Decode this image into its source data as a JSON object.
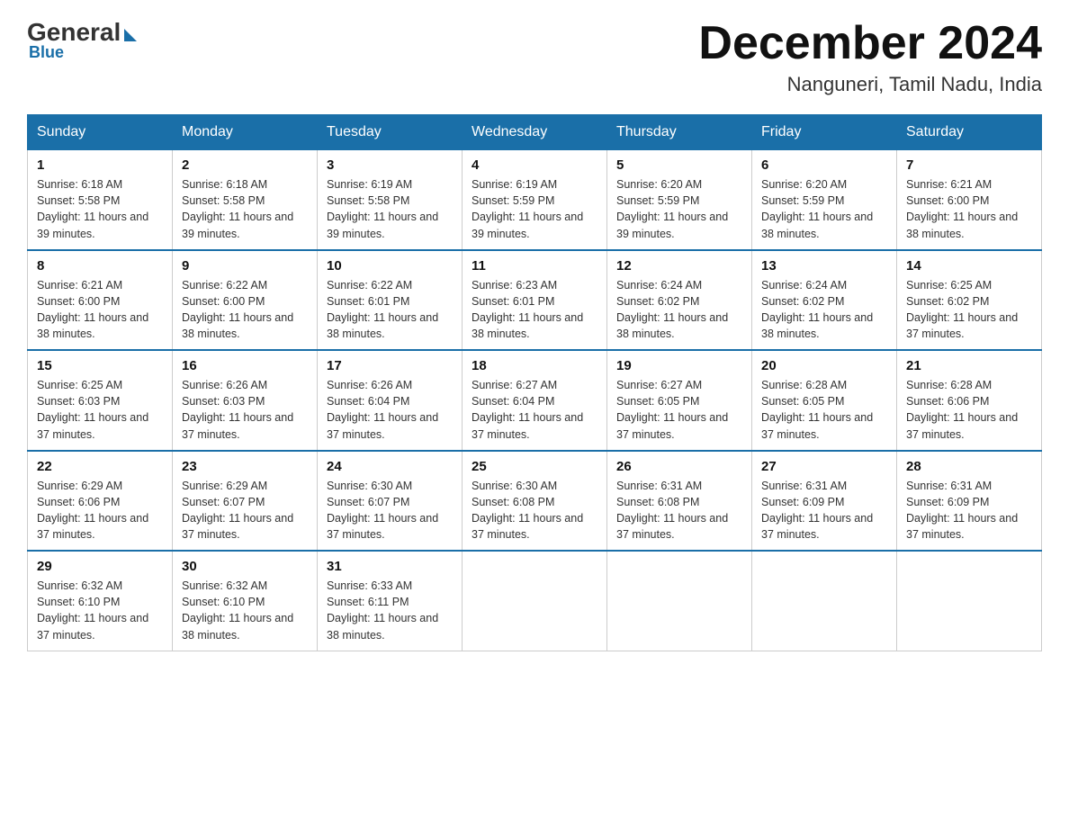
{
  "header": {
    "logo_general": "General",
    "logo_blue": "Blue",
    "month_title": "December 2024",
    "location": "Nanguneri, Tamil Nadu, India"
  },
  "days_of_week": [
    "Sunday",
    "Monday",
    "Tuesday",
    "Wednesday",
    "Thursday",
    "Friday",
    "Saturday"
  ],
  "weeks": [
    [
      {
        "day": "1",
        "sunrise": "6:18 AM",
        "sunset": "5:58 PM",
        "daylight": "11 hours and 39 minutes."
      },
      {
        "day": "2",
        "sunrise": "6:18 AM",
        "sunset": "5:58 PM",
        "daylight": "11 hours and 39 minutes."
      },
      {
        "day": "3",
        "sunrise": "6:19 AM",
        "sunset": "5:58 PM",
        "daylight": "11 hours and 39 minutes."
      },
      {
        "day": "4",
        "sunrise": "6:19 AM",
        "sunset": "5:59 PM",
        "daylight": "11 hours and 39 minutes."
      },
      {
        "day": "5",
        "sunrise": "6:20 AM",
        "sunset": "5:59 PM",
        "daylight": "11 hours and 39 minutes."
      },
      {
        "day": "6",
        "sunrise": "6:20 AM",
        "sunset": "5:59 PM",
        "daylight": "11 hours and 38 minutes."
      },
      {
        "day": "7",
        "sunrise": "6:21 AM",
        "sunset": "6:00 PM",
        "daylight": "11 hours and 38 minutes."
      }
    ],
    [
      {
        "day": "8",
        "sunrise": "6:21 AM",
        "sunset": "6:00 PM",
        "daylight": "11 hours and 38 minutes."
      },
      {
        "day": "9",
        "sunrise": "6:22 AM",
        "sunset": "6:00 PM",
        "daylight": "11 hours and 38 minutes."
      },
      {
        "day": "10",
        "sunrise": "6:22 AM",
        "sunset": "6:01 PM",
        "daylight": "11 hours and 38 minutes."
      },
      {
        "day": "11",
        "sunrise": "6:23 AM",
        "sunset": "6:01 PM",
        "daylight": "11 hours and 38 minutes."
      },
      {
        "day": "12",
        "sunrise": "6:24 AM",
        "sunset": "6:02 PM",
        "daylight": "11 hours and 38 minutes."
      },
      {
        "day": "13",
        "sunrise": "6:24 AM",
        "sunset": "6:02 PM",
        "daylight": "11 hours and 38 minutes."
      },
      {
        "day": "14",
        "sunrise": "6:25 AM",
        "sunset": "6:02 PM",
        "daylight": "11 hours and 37 minutes."
      }
    ],
    [
      {
        "day": "15",
        "sunrise": "6:25 AM",
        "sunset": "6:03 PM",
        "daylight": "11 hours and 37 minutes."
      },
      {
        "day": "16",
        "sunrise": "6:26 AM",
        "sunset": "6:03 PM",
        "daylight": "11 hours and 37 minutes."
      },
      {
        "day": "17",
        "sunrise": "6:26 AM",
        "sunset": "6:04 PM",
        "daylight": "11 hours and 37 minutes."
      },
      {
        "day": "18",
        "sunrise": "6:27 AM",
        "sunset": "6:04 PM",
        "daylight": "11 hours and 37 minutes."
      },
      {
        "day": "19",
        "sunrise": "6:27 AM",
        "sunset": "6:05 PM",
        "daylight": "11 hours and 37 minutes."
      },
      {
        "day": "20",
        "sunrise": "6:28 AM",
        "sunset": "6:05 PM",
        "daylight": "11 hours and 37 minutes."
      },
      {
        "day": "21",
        "sunrise": "6:28 AM",
        "sunset": "6:06 PM",
        "daylight": "11 hours and 37 minutes."
      }
    ],
    [
      {
        "day": "22",
        "sunrise": "6:29 AM",
        "sunset": "6:06 PM",
        "daylight": "11 hours and 37 minutes."
      },
      {
        "day": "23",
        "sunrise": "6:29 AM",
        "sunset": "6:07 PM",
        "daylight": "11 hours and 37 minutes."
      },
      {
        "day": "24",
        "sunrise": "6:30 AM",
        "sunset": "6:07 PM",
        "daylight": "11 hours and 37 minutes."
      },
      {
        "day": "25",
        "sunrise": "6:30 AM",
        "sunset": "6:08 PM",
        "daylight": "11 hours and 37 minutes."
      },
      {
        "day": "26",
        "sunrise": "6:31 AM",
        "sunset": "6:08 PM",
        "daylight": "11 hours and 37 minutes."
      },
      {
        "day": "27",
        "sunrise": "6:31 AM",
        "sunset": "6:09 PM",
        "daylight": "11 hours and 37 minutes."
      },
      {
        "day": "28",
        "sunrise": "6:31 AM",
        "sunset": "6:09 PM",
        "daylight": "11 hours and 37 minutes."
      }
    ],
    [
      {
        "day": "29",
        "sunrise": "6:32 AM",
        "sunset": "6:10 PM",
        "daylight": "11 hours and 37 minutes."
      },
      {
        "day": "30",
        "sunrise": "6:32 AM",
        "sunset": "6:10 PM",
        "daylight": "11 hours and 38 minutes."
      },
      {
        "day": "31",
        "sunrise": "6:33 AM",
        "sunset": "6:11 PM",
        "daylight": "11 hours and 38 minutes."
      },
      null,
      null,
      null,
      null
    ]
  ]
}
